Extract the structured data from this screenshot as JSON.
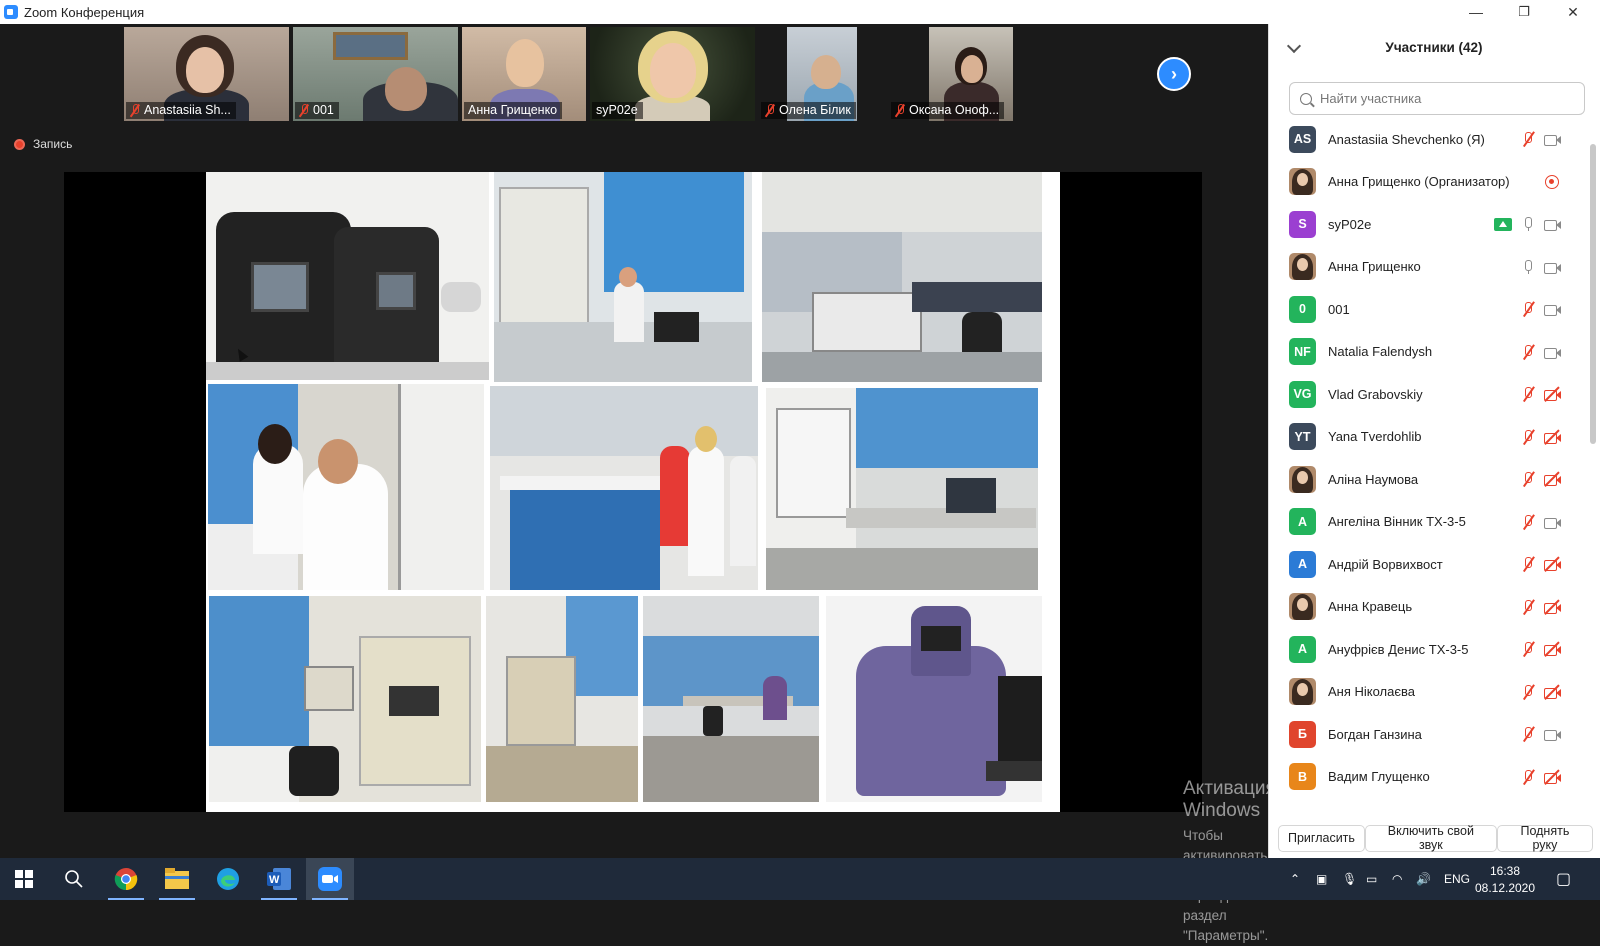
{
  "window": {
    "title": "Zoom Конференция",
    "controls": {
      "minimize": "—",
      "restore": "❐",
      "close": "✕"
    }
  },
  "thumbnails": [
    {
      "name": "Anastasiia Sh...",
      "muted": true,
      "speaking": false
    },
    {
      "name": "001",
      "muted": true,
      "speaking": false
    },
    {
      "name": "Анна Грищенко",
      "muted": false,
      "speaking": false
    },
    {
      "name": "syP02e",
      "muted": false,
      "speaking": true
    },
    {
      "name": "Олена Білик",
      "muted": true,
      "speaking": false
    },
    {
      "name": "Оксана Оноф...",
      "muted": true,
      "speaking": false
    }
  ],
  "next_page_icon": "chevron-right-icon",
  "recording": {
    "label": "Запись"
  },
  "shared_screen": {
    "photos": [
      "pcr-machines-photo",
      "lab-scientist-photo",
      "lab-room-photo",
      "biosafety-cabinet-photo",
      "lab-team-photo",
      "lab-bench-photo",
      "sequencer-photo",
      "lab-equipment-photo",
      "lab-office-photo",
      "thermocycler-photo"
    ]
  },
  "participants_panel": {
    "title": "Участники (42)",
    "search_placeholder": "Найти участника",
    "participants": [
      {
        "initials": "AS",
        "avatar_color": "#3c4a5c",
        "name": "Anastasiia Shevchenko (Я)",
        "mic": "off",
        "video": "on"
      },
      {
        "initials": "",
        "avatar_color": "photo",
        "name": "Анна Грищенко (Организатор)",
        "mic": "none",
        "video": "rec"
      },
      {
        "initials": "S",
        "avatar_color": "#9b3fd1",
        "name": "syP02e",
        "mic": "on",
        "video": "on",
        "sharing": true
      },
      {
        "initials": "",
        "avatar_color": "photo",
        "name": "Анна Грищенко",
        "mic": "on",
        "video": "on"
      },
      {
        "initials": "0",
        "avatar_color": "#23b45c",
        "name": "001",
        "mic": "off",
        "video": "on"
      },
      {
        "initials": "NF",
        "avatar_color": "#23b45c",
        "name": "Natalia Falendysh",
        "mic": "off",
        "video": "on"
      },
      {
        "initials": "VG",
        "avatar_color": "#23b45c",
        "name": "Vlad Grabovskiy",
        "mic": "off",
        "video": "off"
      },
      {
        "initials": "YT",
        "avatar_color": "#3c4a5c",
        "name": "Yana Tverdohlib",
        "mic": "off",
        "video": "off"
      },
      {
        "initials": "",
        "avatar_color": "photo",
        "name": "Аліна Наумова",
        "mic": "off",
        "video": "off"
      },
      {
        "initials": "A",
        "avatar_color": "#23b45c",
        "name": "Ангеліна Вінник ТХ-3-5",
        "mic": "off",
        "video": "on"
      },
      {
        "initials": "A",
        "avatar_color": "#2b7bd6",
        "name": "Андрій Ворвихвост",
        "mic": "off",
        "video": "off"
      },
      {
        "initials": "",
        "avatar_color": "photo",
        "name": "Анна Кравець",
        "mic": "off",
        "video": "off"
      },
      {
        "initials": "A",
        "avatar_color": "#23b45c",
        "name": "Ануфрієв Денис ТХ-3-5",
        "mic": "off",
        "video": "off"
      },
      {
        "initials": "",
        "avatar_color": "photo",
        "name": "Аня Ніколаєва",
        "mic": "off",
        "video": "off"
      },
      {
        "initials": "Б",
        "avatar_color": "#e0452d",
        "name": "Богдан Ганзина",
        "mic": "off",
        "video": "on"
      },
      {
        "initials": "B",
        "avatar_color": "#e8861a",
        "name": "Вадим Глущенко",
        "mic": "off",
        "video": "off"
      }
    ],
    "buttons": {
      "invite": "Пригласить",
      "unmute": "Включить свой звук",
      "raise_hand": "Поднять руку"
    }
  },
  "watermark": {
    "line1": "Активация Windows",
    "line2": "Чтобы активировать Windows, перейдите в раздел",
    "line3": "\"Параметры\"."
  },
  "taskbar": {
    "apps": [
      "windows-start-icon",
      "search-icon",
      "chrome-icon",
      "file-explorer-icon",
      "edge-icon",
      "word-icon",
      "zoom-icon"
    ],
    "language": "ENG",
    "time": "16:38",
    "date": "08.12.2020"
  }
}
